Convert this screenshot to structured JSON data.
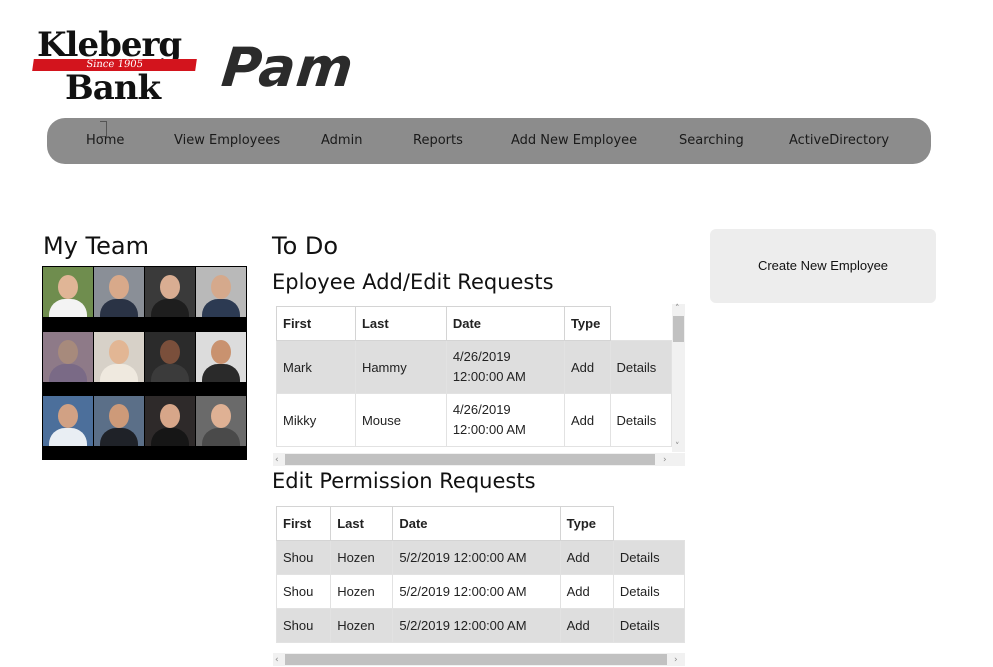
{
  "logo": {
    "line1": "Kleberg",
    "since": "Since 1905",
    "line2": "Bank"
  },
  "brand": "Pam",
  "nav": [
    "Home",
    "View Employees",
    "Admin",
    "Reports",
    "Add New Employee",
    "Searching",
    "ActiveDirectory"
  ],
  "team": {
    "title": "My Team"
  },
  "todo": {
    "title": "To Do"
  },
  "add_edit": {
    "title": "Eployee Add/Edit Requests",
    "headers": [
      "First",
      "Last",
      "Date",
      "Type"
    ],
    "rows": [
      {
        "first": "Mark",
        "last": "Hammy",
        "date1": "4/26/2019",
        "date2": "12:00:00 AM",
        "type": "Add",
        "action": "Details"
      },
      {
        "first": "Mikky",
        "last": "Mouse",
        "date1": "4/26/2019",
        "date2": "12:00:00 AM",
        "type": "Add",
        "action": "Details"
      }
    ]
  },
  "permission": {
    "title": "Edit Permission Requests",
    "headers": [
      "First",
      "Last",
      "Date",
      "Type"
    ],
    "rows": [
      {
        "first": "Shou",
        "last": "Hozen",
        "date": "5/2/2019 12:00:00 AM",
        "type": "Add",
        "action": "Details"
      },
      {
        "first": "Shou",
        "last": "Hozen",
        "date": "5/2/2019 12:00:00 AM",
        "type": "Add",
        "action": "Details"
      },
      {
        "first": "Shou",
        "last": "Hozen",
        "date": "5/2/2019 12:00:00 AM",
        "type": "Add",
        "action": "Details"
      }
    ]
  },
  "create_button": "Create New Employee",
  "colors": {
    "nav_bg": "#8c8c8c",
    "row_shade": "#dedede",
    "logo_red": "#d3141d",
    "button_bg": "#ededed"
  }
}
